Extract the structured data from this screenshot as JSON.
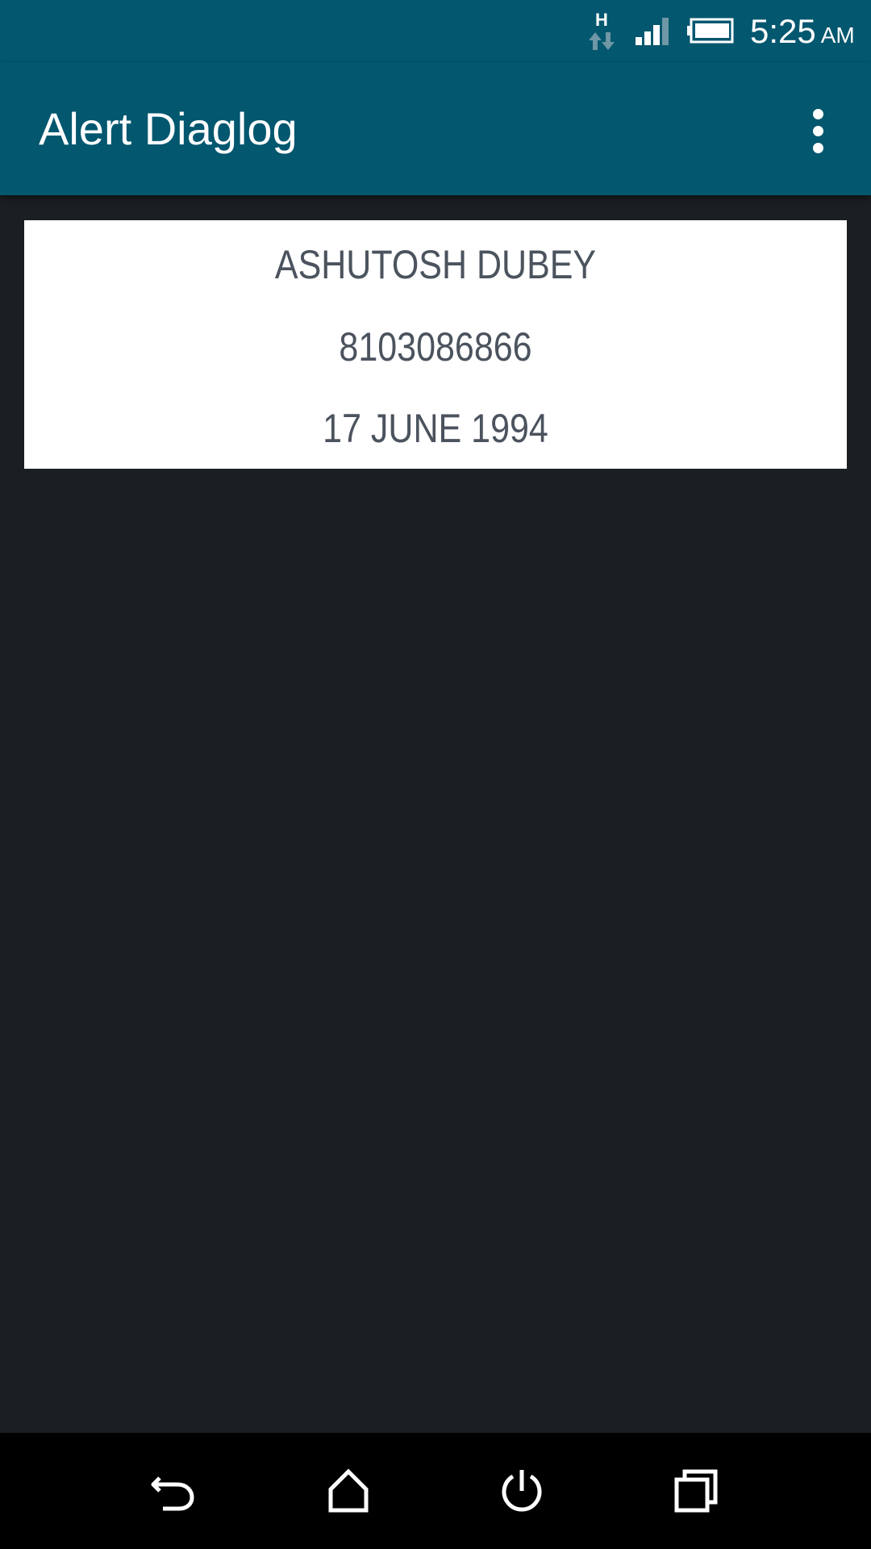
{
  "status_bar": {
    "network_type": "H",
    "time": "5:25",
    "ampm": "AM",
    "icons": [
      "data-transfer-icon",
      "signal-icon",
      "battery-icon"
    ],
    "background_color": "#03576f"
  },
  "app_bar": {
    "title": "Alert Diaglog",
    "overflow_icon": "more-vert-icon",
    "background_color": "#03576f"
  },
  "card": {
    "name": "ASHUTOSH DUBEY",
    "phone": "8103086866",
    "dob": "17 JUNE 1994",
    "text_color": "#4b535e"
  },
  "nav_bar": {
    "buttons": [
      "back-icon",
      "home-icon",
      "power-icon",
      "recent-apps-icon"
    ]
  }
}
